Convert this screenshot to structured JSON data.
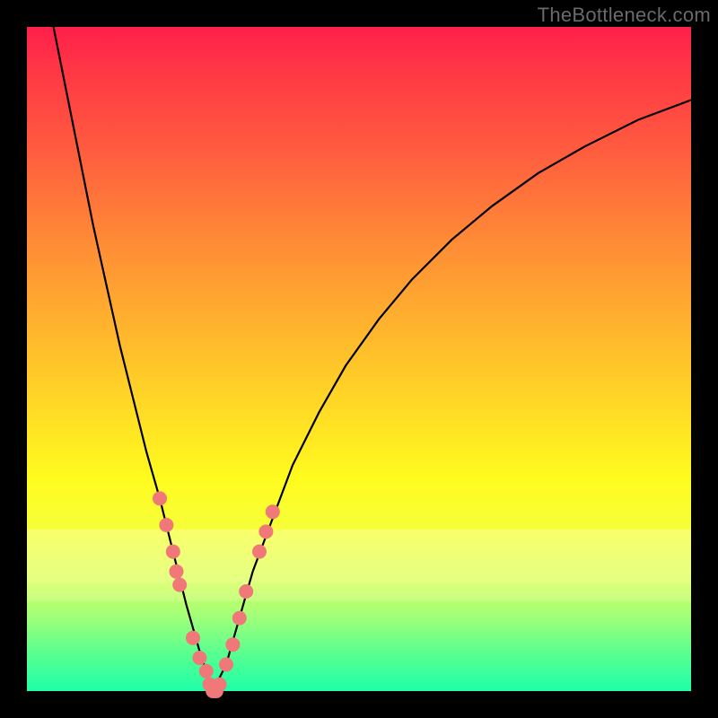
{
  "watermark": "TheBottleneck.com",
  "chart_data": {
    "type": "line",
    "title": "",
    "xlabel": "",
    "ylabel": "",
    "xlim": [
      0,
      100
    ],
    "ylim": [
      0,
      100
    ],
    "grid": false,
    "legend": false,
    "series": [
      {
        "name": "bottleneck-curve",
        "color": "#000000",
        "x": [
          4,
          6,
          8,
          10,
          12,
          14,
          16,
          18,
          20,
          22,
          24,
          26,
          27,
          28,
          30,
          32,
          34,
          37,
          40,
          44,
          48,
          53,
          58,
          64,
          70,
          77,
          84,
          92,
          100
        ],
        "y": [
          100,
          90,
          80,
          70,
          61,
          52,
          44,
          36,
          29,
          21,
          13,
          6,
          3,
          0,
          4,
          11,
          18,
          26,
          34,
          42,
          49,
          56,
          62,
          68,
          73,
          78,
          82,
          86,
          89
        ]
      }
    ],
    "markers": {
      "name": "highlighted-points",
      "color": "#f07878",
      "points": [
        {
          "x": 20,
          "y": 29
        },
        {
          "x": 21,
          "y": 25
        },
        {
          "x": 22,
          "y": 21
        },
        {
          "x": 22.5,
          "y": 18
        },
        {
          "x": 23,
          "y": 16
        },
        {
          "x": 25,
          "y": 8
        },
        {
          "x": 26,
          "y": 5
        },
        {
          "x": 27,
          "y": 3
        },
        {
          "x": 27.5,
          "y": 1
        },
        {
          "x": 28,
          "y": 0
        },
        {
          "x": 28.5,
          "y": 0
        },
        {
          "x": 29,
          "y": 1
        },
        {
          "x": 30,
          "y": 4
        },
        {
          "x": 31,
          "y": 7
        },
        {
          "x": 32,
          "y": 11
        },
        {
          "x": 33,
          "y": 15
        },
        {
          "x": 35,
          "y": 21
        },
        {
          "x": 36,
          "y": 24
        },
        {
          "x": 37,
          "y": 27
        }
      ]
    },
    "bands": [
      {
        "name": "pale-yellow-band",
        "y_from": 15,
        "y_to": 24,
        "color": "rgba(255,255,200,0.35)"
      },
      {
        "name": "pale-band-2",
        "y_from": 12,
        "y_to": 15,
        "color": "rgba(255,255,220,0.2)"
      }
    ]
  }
}
